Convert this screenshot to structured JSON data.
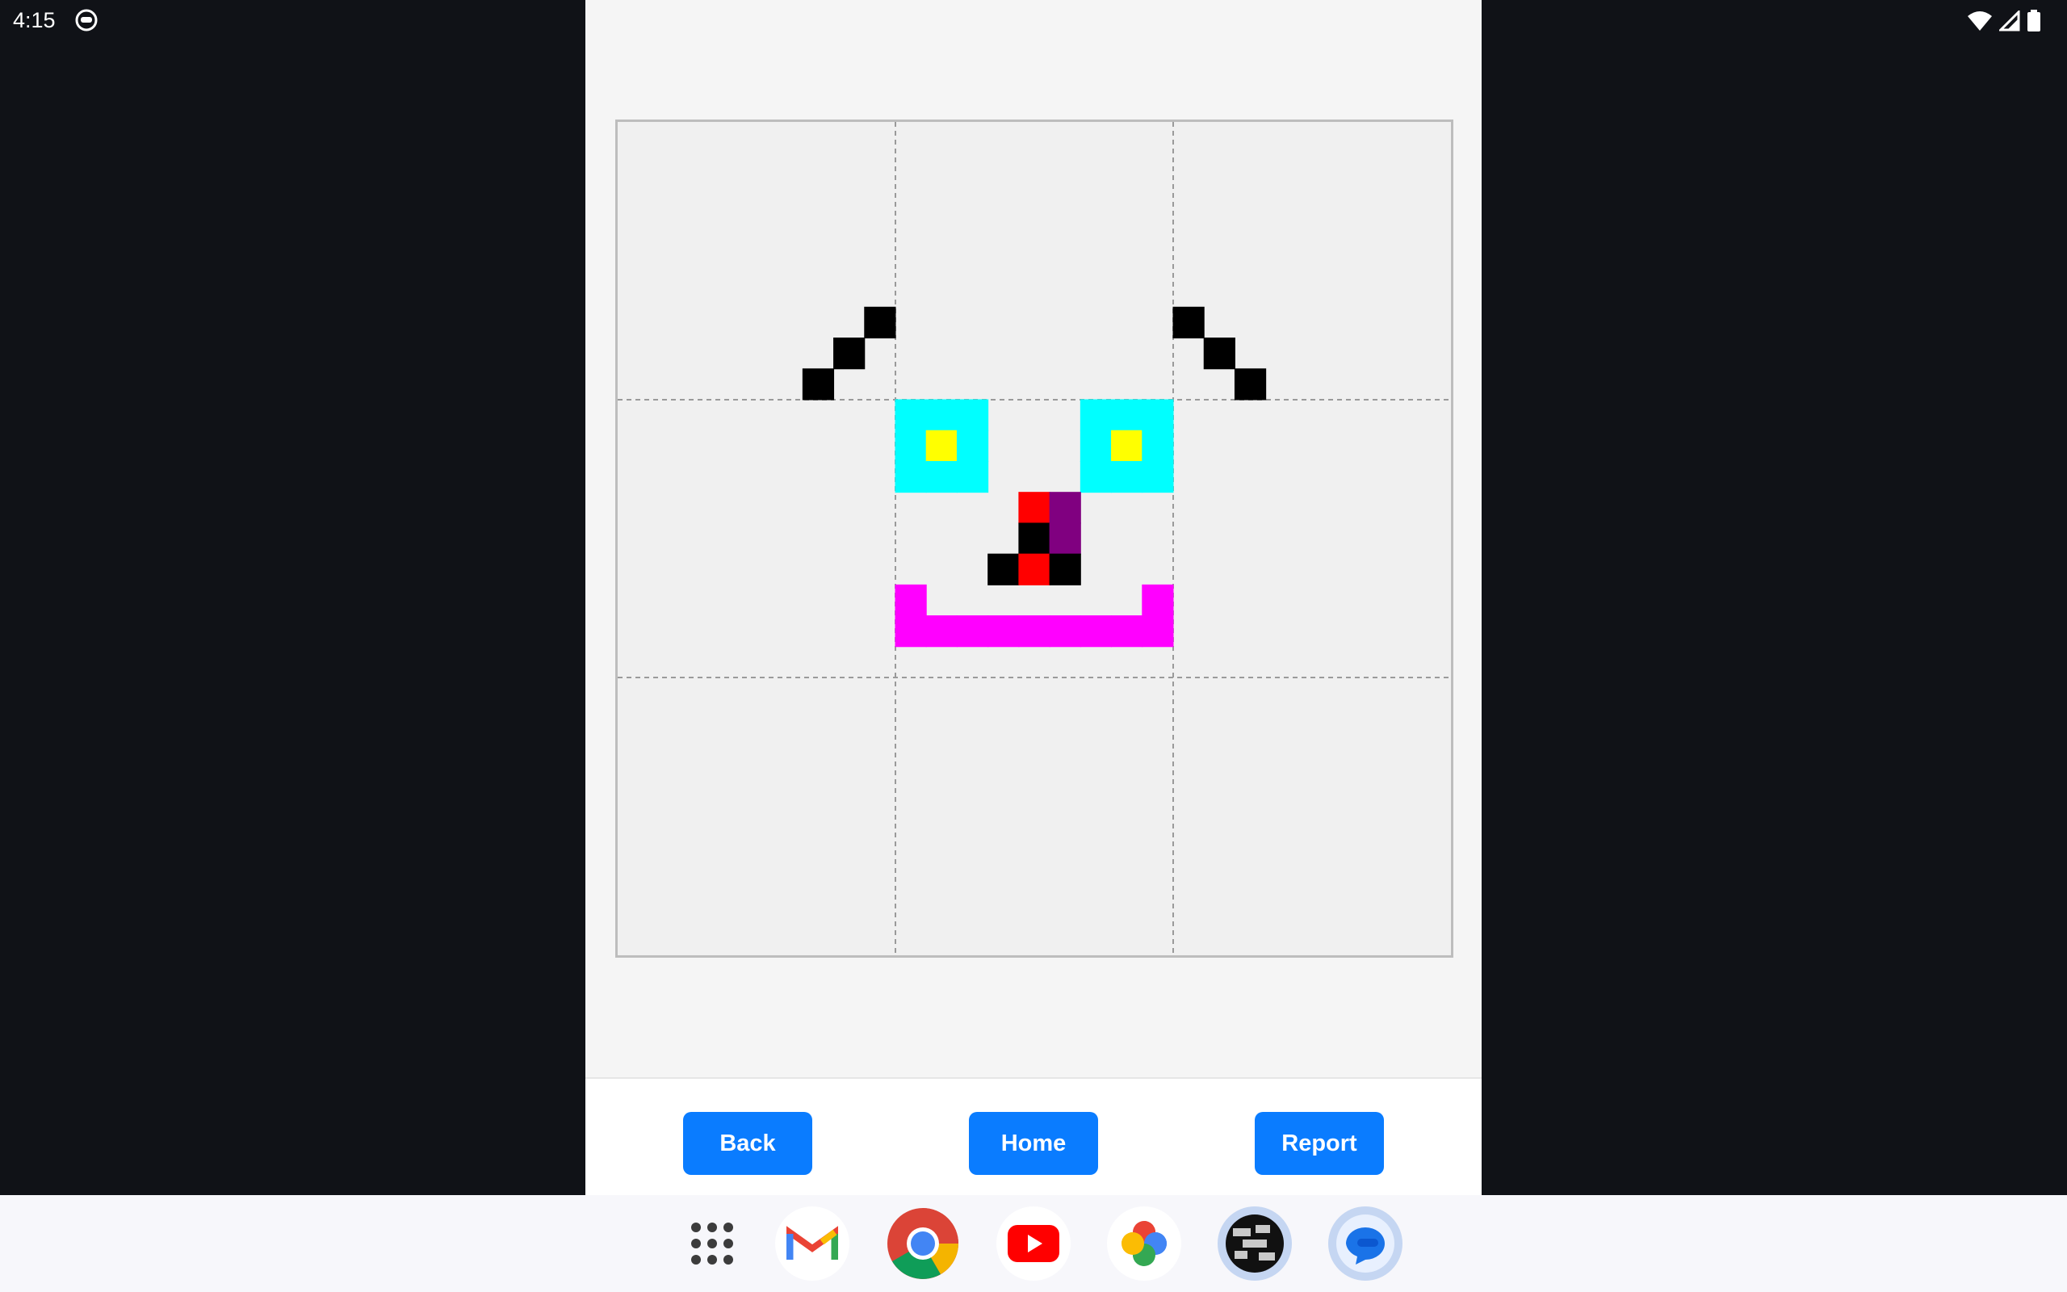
{
  "status_bar": {
    "time": "4:15",
    "notification_icon": "emoji-face-icon",
    "right_icons": [
      "wifi-icon",
      "signal-icon",
      "battery-icon"
    ]
  },
  "canvas": {
    "grid_divisions": 3,
    "colors": {
      "background": "#f0f0f0",
      "black": "#000000",
      "cyan": "#00ffff",
      "yellow": "#ffff00",
      "red": "#ff0000",
      "purple": "#800080",
      "magenta": "#ff00ff"
    }
  },
  "buttons": {
    "back_label": "Back",
    "home_label": "Home",
    "report_label": "Report"
  },
  "taskbar": {
    "apps": [
      "app-drawer-icon",
      "gmail-icon",
      "chrome-icon",
      "youtube-icon",
      "photos-icon",
      "app-icon",
      "messages-icon"
    ]
  }
}
